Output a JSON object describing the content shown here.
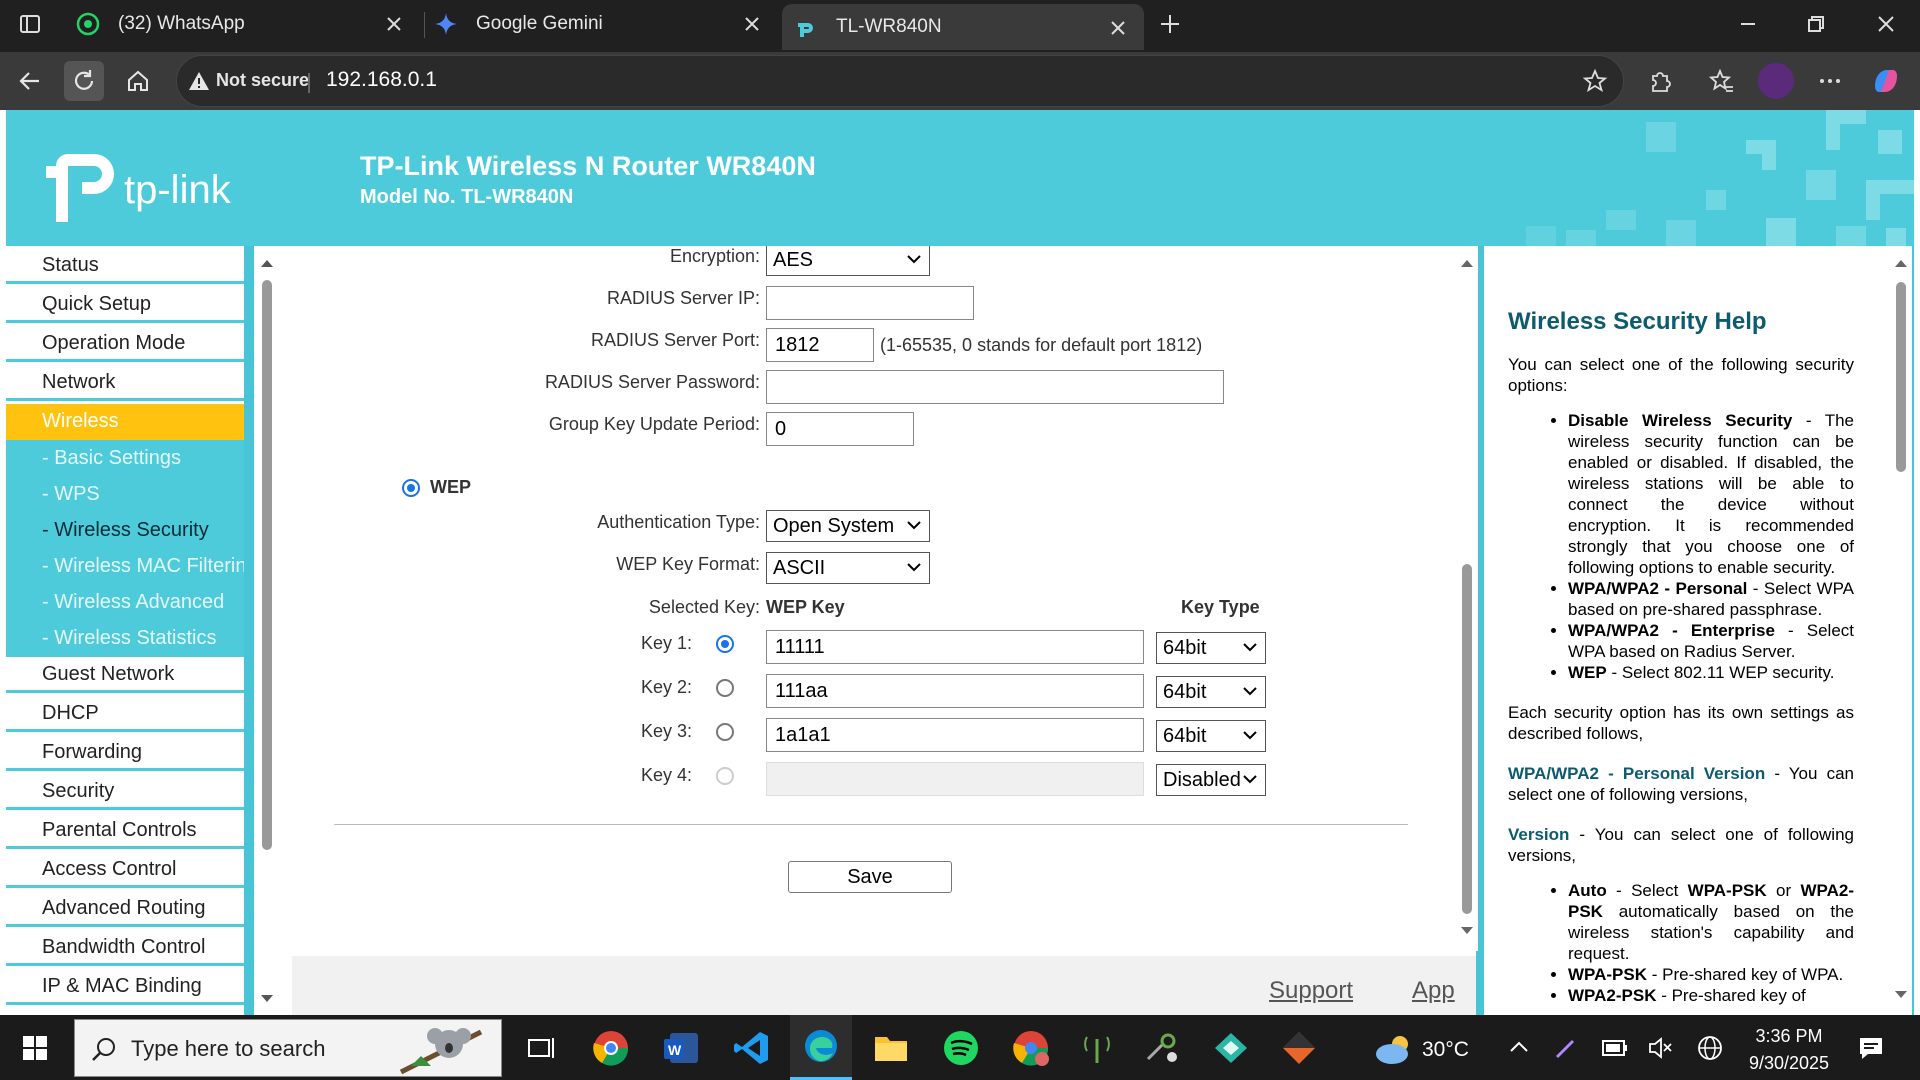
{
  "browser": {
    "tabs": [
      {
        "label": "(32) WhatsApp",
        "icon": "whatsapp-icon"
      },
      {
        "label": "Google Gemini",
        "icon": "gemini-icon"
      },
      {
        "label": "TL-WR840N",
        "icon": "tplink-icon"
      }
    ],
    "security_label": "Not secure",
    "url": "192.168.0.1"
  },
  "header": {
    "logo_text": "tp-link",
    "title": "TP-Link Wireless N Router WR840N",
    "model": "Model No. TL-WR840N"
  },
  "nav": {
    "items": [
      "Status",
      "Quick Setup",
      "Operation Mode",
      "Network",
      "Wireless"
    ],
    "sub_items": [
      "- Basic Settings",
      "- WPS",
      "- Wireless Security",
      "- Wireless MAC Filtering",
      "- Wireless Advanced",
      "- Wireless Statistics"
    ],
    "items_after": [
      "Guest Network",
      "DHCP",
      "Forwarding",
      "Security",
      "Parental Controls",
      "Access Control",
      "Advanced Routing",
      "Bandwidth Control",
      "IP & MAC Binding"
    ]
  },
  "form": {
    "encryption_label": "Encryption:",
    "encryption_value": "AES",
    "radius_ip_label": "RADIUS Server IP:",
    "radius_ip_value": "",
    "radius_port_label": "RADIUS Server Port:",
    "radius_port_value": "1812",
    "radius_port_hint": "(1-65535, 0 stands for default port 1812)",
    "radius_pw_label": "RADIUS Server Password:",
    "radius_pw_value": "",
    "group_key_label": "Group Key Update Period:",
    "group_key_value": "0",
    "wep_label": "WEP",
    "auth_type_label": "Authentication Type:",
    "auth_type_value": "Open System",
    "key_format_label": "WEP Key Format:",
    "key_format_value": "ASCII",
    "selected_key_label": "Selected Key:",
    "wep_key_header": "WEP Key",
    "key_type_header": "Key Type",
    "keys": [
      {
        "label": "Key 1:",
        "value": "11111",
        "type": "64bit"
      },
      {
        "label": "Key 2:",
        "value": "111aa",
        "type": "64bit"
      },
      {
        "label": "Key 3:",
        "value": "1a1a1",
        "type": "64bit"
      },
      {
        "label": "Key 4:",
        "value": "",
        "type": "Disabled"
      }
    ],
    "save_label": "Save",
    "support_link": "Support",
    "app_link": "App"
  },
  "help": {
    "title": "Wireless Security Help",
    "intro": "You can select one of the following security options:",
    "opt1_b": "Disable Wireless Security",
    "opt1_t": " - The wireless security function can be enabled or disabled. If disabled, the wireless stations will be able to connect the device without encryption. It is recommended strongly that you choose one of following options to enable security.",
    "opt2_b": "WPA/WPA2 - Personal",
    "opt2_t": " - Select WPA based on pre-shared passphrase.",
    "opt3_b": "WPA/WPA2 - Enterprise",
    "opt3_t": " - Select WPA based on Radius Server.",
    "opt4_b": "WEP",
    "opt4_t": " - Select 802.11 WEP security.",
    "para2": "Each security option has its own settings as described follows,",
    "pv_b": "WPA/WPA2 - Personal Version",
    "pv_t": " - You can select one of following versions,",
    "ver_b": "Version",
    "ver_t": " - You can select one of following versions,",
    "auto_b": "Auto",
    "auto_t1": " - Select ",
    "auto_b2": "WPA-PSK",
    "auto_t2": " or ",
    "auto_b3": "WPA2-PSK",
    "auto_t3": " automatically based on the wireless station's capability and request.",
    "wpapsk_b": "WPA-PSK",
    "wpapsk_t": " - Pre-shared key of WPA.",
    "wpa2psk_b": "WPA2-PSK",
    "wpa2psk_t": " - Pre-shared key of"
  },
  "taskbar": {
    "search_placeholder": "Type here to search",
    "weather": "30°C",
    "time": "3:36 PM",
    "date": "9/30/2025"
  },
  "colors": {
    "accent": "#4ecbdb",
    "highlight": "#ffc20e",
    "chrome_bg": "#202020"
  }
}
